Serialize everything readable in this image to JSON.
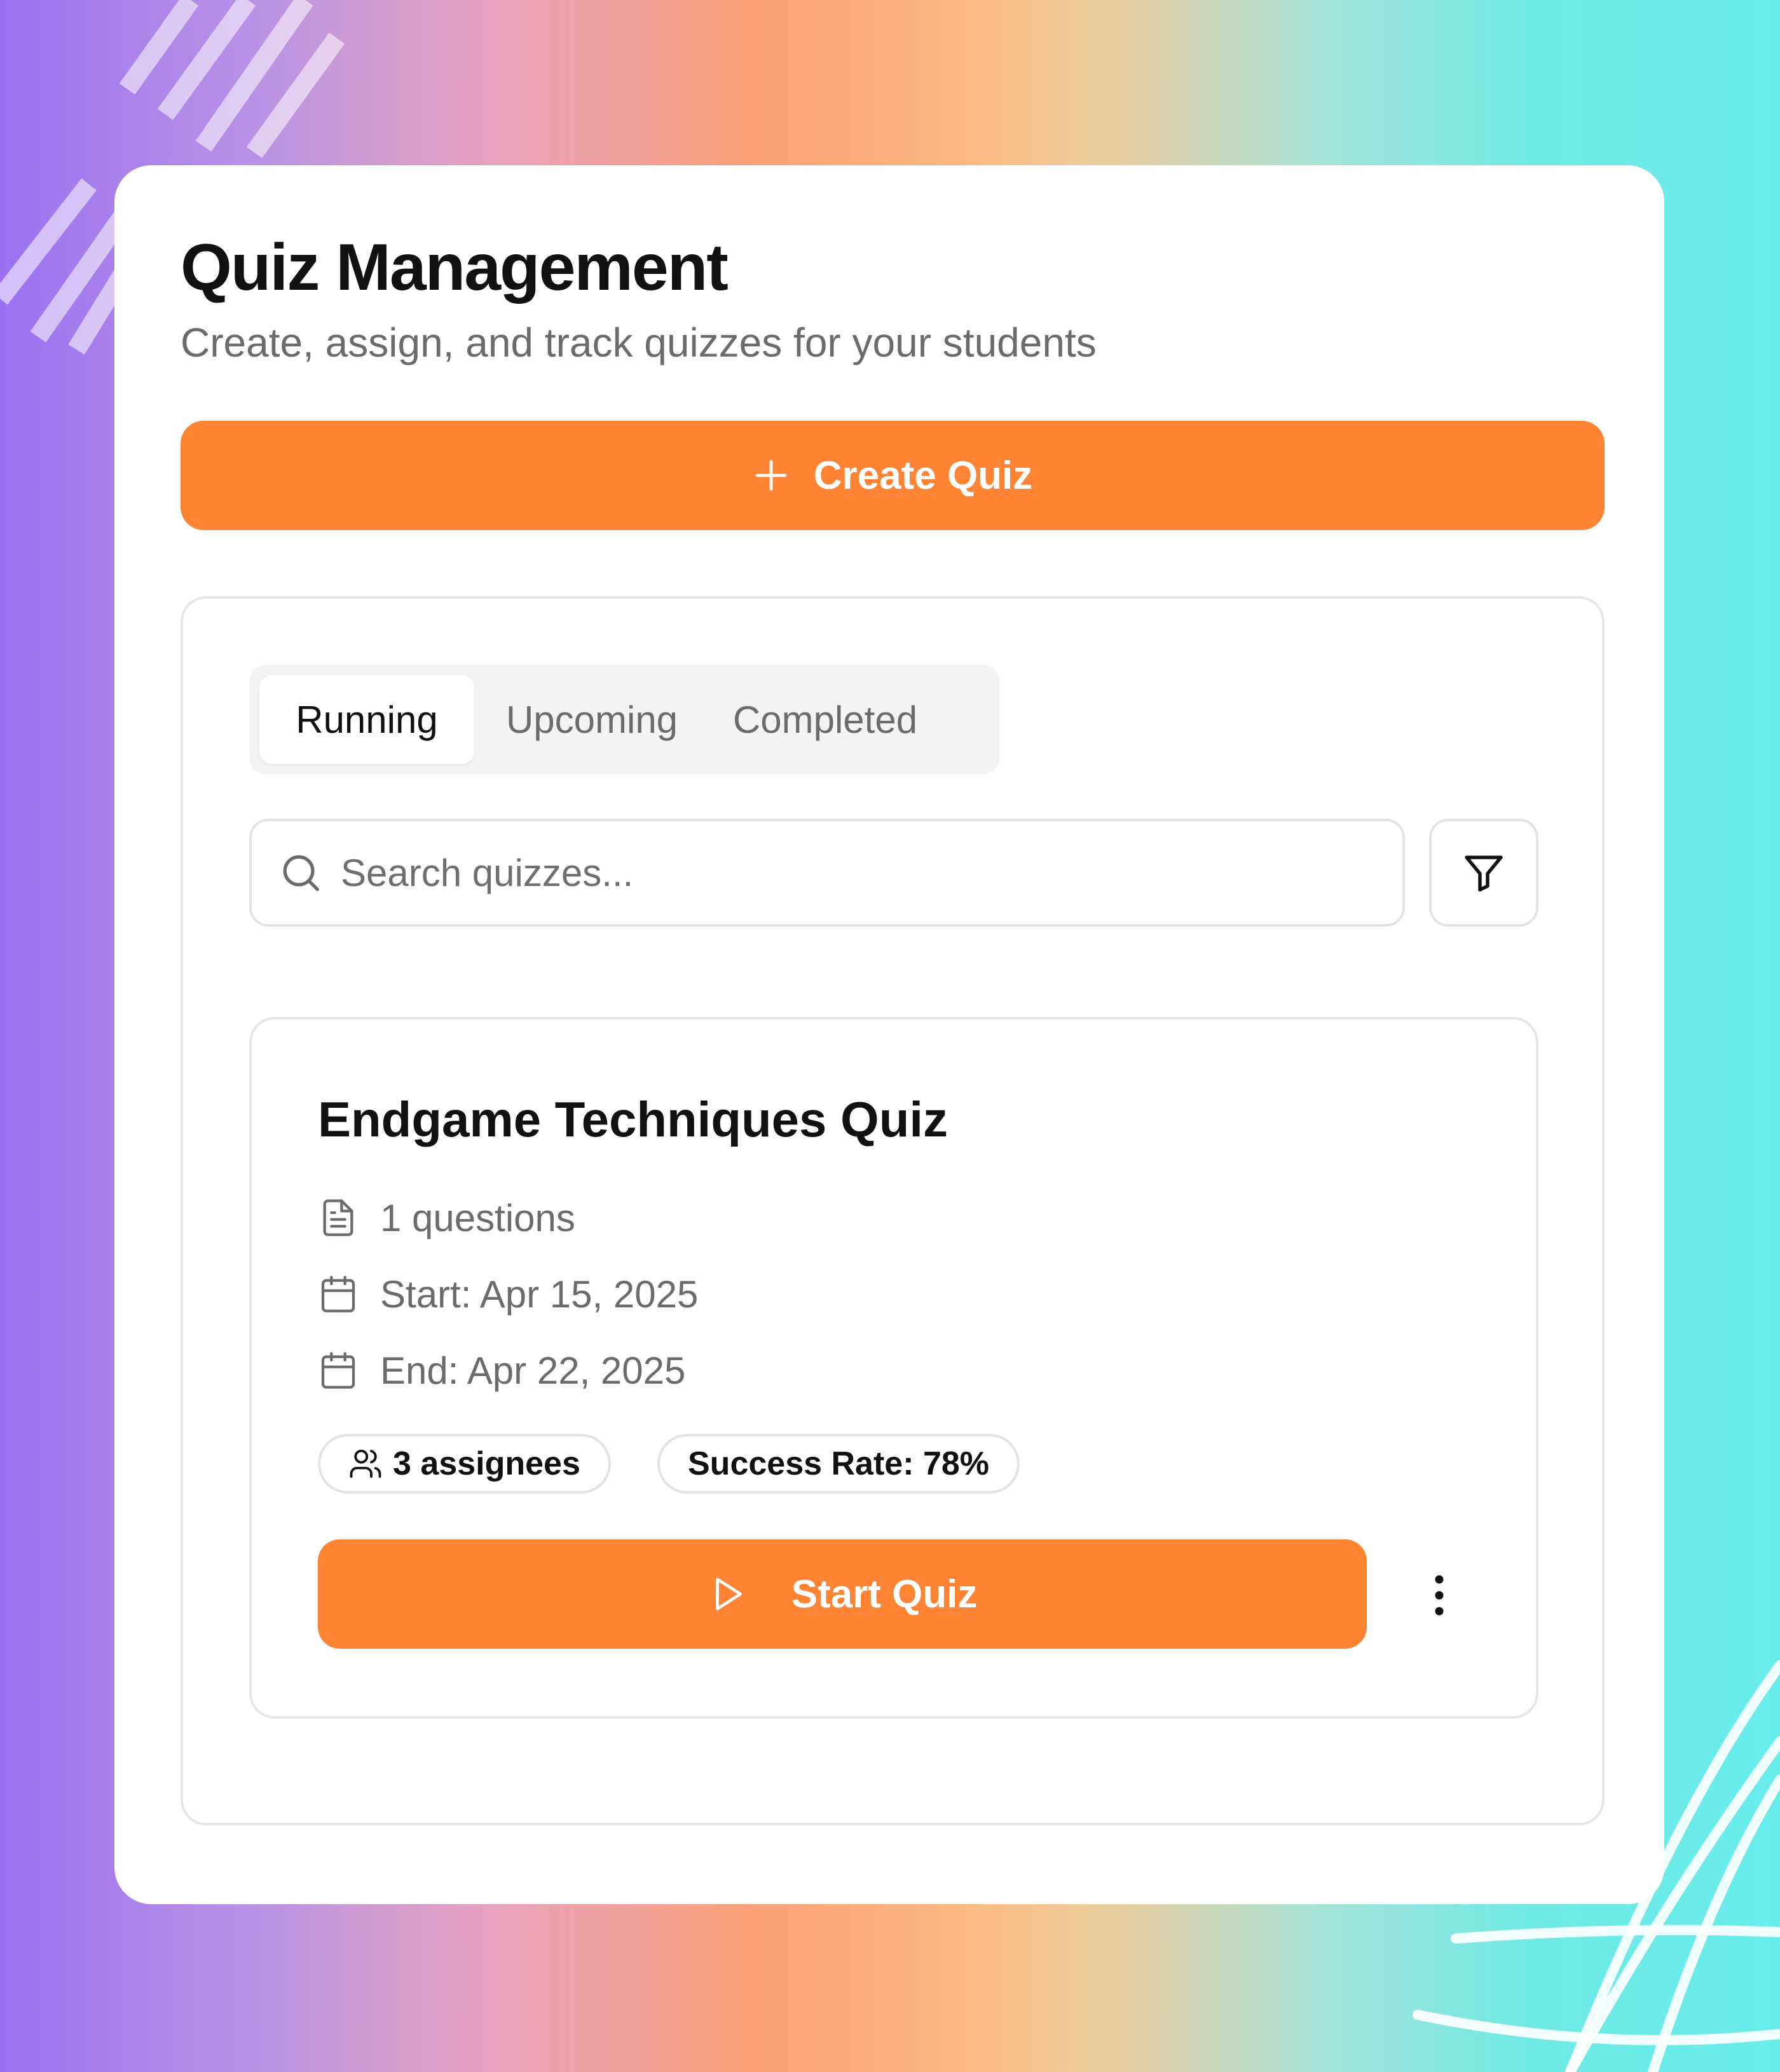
{
  "header": {
    "title": "Quiz Management",
    "subtitle": "Create, assign, and track quizzes for your students"
  },
  "actions": {
    "create_label": "Create Quiz"
  },
  "tabs": [
    {
      "label": "Running",
      "active": true
    },
    {
      "label": "Upcoming",
      "active": false
    },
    {
      "label": "Completed",
      "active": false
    }
  ],
  "search": {
    "placeholder": "Search quizzes...",
    "value": ""
  },
  "quiz": {
    "title": "Endgame Techniques Quiz",
    "questions": "1 questions",
    "start": "Start: Apr 15, 2025",
    "end": "End: Apr 22, 2025",
    "assignees": "3 assignees",
    "success_rate": "Success Rate: 78%",
    "start_label": "Start Quiz"
  },
  "icons": {
    "create": "plus-icon",
    "search": "search-icon",
    "filter": "filter-icon",
    "questions": "file-text-icon",
    "start": "calendar-icon",
    "end": "calendar-icon",
    "assignees": "users-icon",
    "start_quiz": "play-icon",
    "more": "more-vertical-icon"
  },
  "colors": {
    "accent": "#fe8433",
    "text_primary": "#111111",
    "text_secondary": "#6b6b6b",
    "border": "#e3e3e3"
  }
}
